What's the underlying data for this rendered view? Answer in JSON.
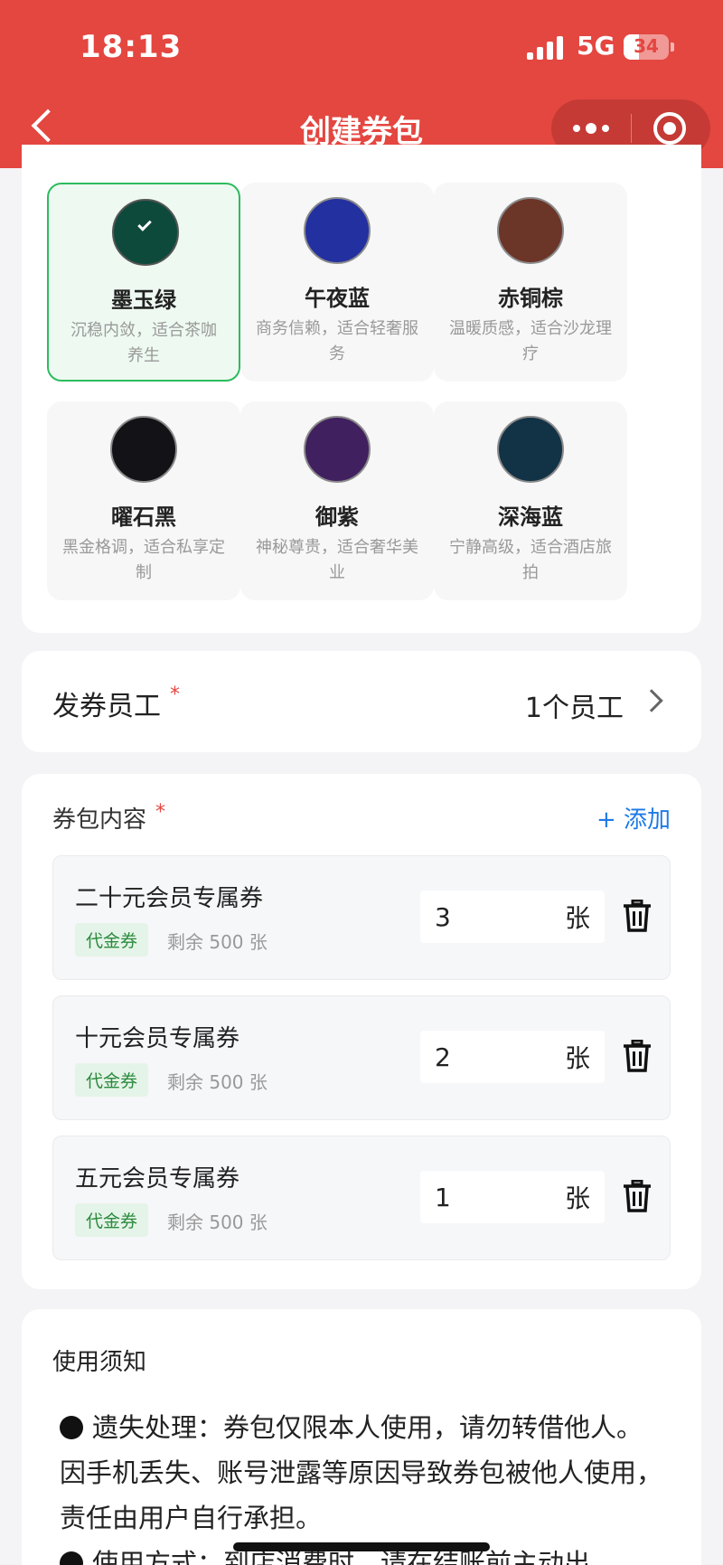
{
  "status_bar": {
    "time": "18:13",
    "network": "5G",
    "battery": "34",
    "battery_level": 0.34
  },
  "nav": {
    "title": "创建券包"
  },
  "themes": [
    {
      "name": "墨玉绿",
      "desc": "沉稳内敛，适合茶咖养生",
      "color": "#0d4a3c",
      "selected": true
    },
    {
      "name": "午夜蓝",
      "desc": "商务信赖，适合轻奢服务",
      "color": "#2330a0",
      "selected": false
    },
    {
      "name": "赤铜棕",
      "desc": "温暖质感，适合沙龙理疗",
      "color": "#6b3528",
      "selected": false
    },
    {
      "name": "曜石黑",
      "desc": "黑金格调，适合私享定制",
      "color": "#121217",
      "selected": false
    },
    {
      "name": "御紫",
      "desc": "神秘尊贵，适合奢华美业",
      "color": "#41205f",
      "selected": false
    },
    {
      "name": "深海蓝",
      "desc": "宁静高级，适合酒店旅拍",
      "color": "#123246",
      "selected": false
    }
  ],
  "staff": {
    "label": "发券员工",
    "required_mark": "*",
    "value": "1个员工"
  },
  "content": {
    "label": "券包内容",
    "required_mark": "*",
    "add_label": "+ 添加",
    "coupons": [
      {
        "name": "二十元会员专属券",
        "tag": "代金券",
        "stock": "剩余 500 张",
        "qty": "3",
        "unit": "张"
      },
      {
        "name": "十元会员专属券",
        "tag": "代金券",
        "stock": "剩余 500 张",
        "qty": "2",
        "unit": "张"
      },
      {
        "name": "五元会员专属券",
        "tag": "代金券",
        "stock": "剩余 500 张",
        "qty": "1",
        "unit": "张"
      }
    ]
  },
  "notice": {
    "title": "使用须知",
    "items": [
      "遗失处理：券包仅限本人使用，请勿转借他人。因手机丢失、账号泄露等原因导致券包被他人使用，责任由用户自行承担。",
      "使用方式：到店消费时，请在结账前主动出"
    ]
  },
  "colors": {
    "brand_red": "#e44640",
    "selected_green": "#2dbb5e",
    "link_blue": "#1e7ae6"
  }
}
